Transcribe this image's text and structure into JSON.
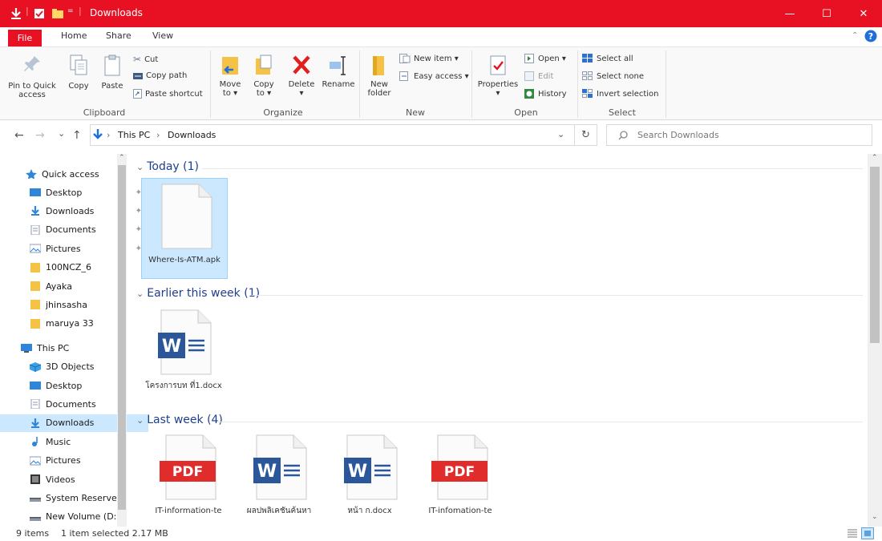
{
  "window": {
    "title": "Downloads",
    "accent": "#e81123",
    "controls": {
      "minimize": "—",
      "maximize": "☐",
      "close": "✕"
    }
  },
  "ribbon_tabs": [
    "File",
    "Home",
    "Share",
    "View"
  ],
  "ribbon": {
    "clipboard": {
      "pin_label_1": "Pin to Quick",
      "pin_label_2": "access",
      "copy": "Copy",
      "paste": "Paste",
      "cut": "Cut",
      "copy_path": "Copy path",
      "paste_shortcut": "Paste shortcut",
      "group": "Clipboard"
    },
    "organize": {
      "move_1": "Move",
      "move_2": "to ▾",
      "copy_1": "Copy",
      "copy_2": "to ▾",
      "delete": "Delete",
      "delete_arrow": "▾",
      "rename": "Rename",
      "group": "Organize"
    },
    "new": {
      "folder_1": "New",
      "folder_2": "folder",
      "new_item": "New item ▾",
      "easy_access": "Easy access ▾",
      "group": "New"
    },
    "open": {
      "properties": "Properties",
      "properties_arrow": "▾",
      "open": "Open ▾",
      "edit": "Edit",
      "history": "History",
      "group": "Open"
    },
    "select": {
      "select_all": "Select all",
      "select_none": "Select none",
      "invert": "Invert selection",
      "group": "Select"
    }
  },
  "address": {
    "back": "←",
    "forward": "→",
    "recent": "⌄",
    "up": "↑",
    "crumbs": [
      "This PC",
      "Downloads"
    ],
    "separator": "›",
    "dropdown": "⌄",
    "refresh": "↻",
    "search_placeholder": "Search Downloads"
  },
  "nav": {
    "quick_access": "Quick access",
    "pinned": [
      {
        "label": "Desktop",
        "icon": "desktop-icon"
      },
      {
        "label": "Downloads",
        "icon": "download-icon"
      },
      {
        "label": "Documents",
        "icon": "documents-icon"
      },
      {
        "label": "Pictures",
        "icon": "pictures-icon"
      }
    ],
    "folders": [
      "100NCZ_6",
      "Ayaka",
      "jhinsasha",
      "maruya 33"
    ],
    "this_pc": "This PC",
    "pc_items": [
      {
        "label": "3D Objects",
        "icon": "3d-objects-icon"
      },
      {
        "label": "Desktop",
        "icon": "desktop-icon"
      },
      {
        "label": "Documents",
        "icon": "documents-icon"
      },
      {
        "label": "Downloads",
        "icon": "download-icon",
        "selected": true
      },
      {
        "label": "Music",
        "icon": "music-icon"
      },
      {
        "label": "Pictures",
        "icon": "pictures-icon"
      },
      {
        "label": "Videos",
        "icon": "videos-icon"
      },
      {
        "label": "System Reservec",
        "icon": "drive-icon"
      },
      {
        "label": "New Volume (D: ⌄",
        "icon": "drive-icon"
      }
    ]
  },
  "groups": [
    {
      "header": "Today (1)",
      "files": [
        {
          "name": "Where-Is-ATM.apk",
          "type": "blank"
        }
      ]
    },
    {
      "header": "Earlier this week (1)",
      "files": [
        {
          "name": "โครงการบท ที่1.docx",
          "type": "word"
        }
      ]
    },
    {
      "header": "Last week (4)",
      "files": [
        {
          "name": "IT-information-te",
          "type": "pdf"
        },
        {
          "name": "ผลปพลิเคชันค้นหา",
          "type": "word"
        },
        {
          "name": "หน้า ก.docx",
          "type": "word"
        },
        {
          "name": "IT-infomation-te",
          "type": "pdf"
        }
      ]
    }
  ],
  "status": {
    "items": "9 items",
    "selected": "1 item selected  2.17 MB"
  },
  "colors": {
    "word": "#2b579a",
    "pdf": "#e12c2c",
    "folder": "#f8d775",
    "selection": "#cce8ff",
    "group_header": "#1e3f8c"
  }
}
